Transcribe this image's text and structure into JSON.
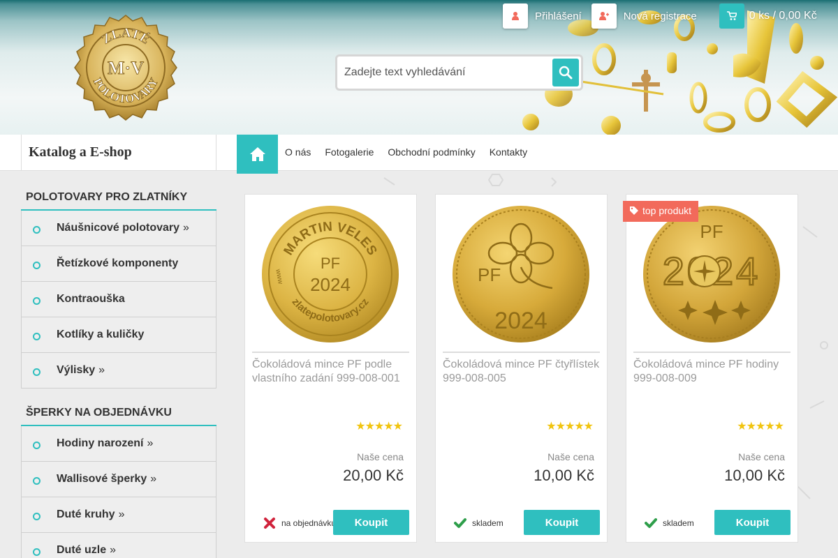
{
  "header": {
    "logo_text": {
      "top": "ZLATÉ",
      "center": "M·V",
      "bottom": "POLOTOVARY"
    },
    "login_label": "Přihlášení",
    "register_label": "Nová registrace",
    "cart_text": "0 ks / 0,00 Kč",
    "search_placeholder": "Zadejte text vyhledávání",
    "icons": {
      "login": "user-icon",
      "register": "user-plus-icon",
      "cart": "cart-icon",
      "search": "search-icon"
    }
  },
  "nav": {
    "catalog_title": "Katalog a E-shop",
    "home_icon": "home-icon",
    "items": [
      "O nás",
      "Fotogalerie",
      "Obchodní podmínky",
      "Kontakty"
    ]
  },
  "sidebar": {
    "sections": [
      {
        "title": "POLOTOVARY PRO ZLATNÍKY",
        "items": [
          {
            "label": "Náušnicové polotovary",
            "arrow": "»"
          },
          {
            "label": "Řetízkové komponenty",
            "arrow": ""
          },
          {
            "label": "Kontraouška",
            "arrow": ""
          },
          {
            "label": "Kotlíky a kuličky",
            "arrow": ""
          },
          {
            "label": "Výlisky",
            "arrow": "»"
          }
        ]
      },
      {
        "title": "ŠPERKY NA OBJEDNÁVKU",
        "items": [
          {
            "label": "Hodiny narození",
            "arrow": "»"
          },
          {
            "label": "Wallisové šperky",
            "arrow": "»"
          },
          {
            "label": "Duté kruhy",
            "arrow": "»"
          },
          {
            "label": "Duté uzle",
            "arrow": "»"
          }
        ]
      }
    ]
  },
  "products": [
    {
      "name": "Čokoládová mince PF podle vlastního zadání 999-008-001",
      "coin_text": {
        "ring": "MARTIN VELES",
        "ring2": "zlatepolotovary.cz",
        "center1": "PF",
        "center2": "2024",
        "side": "www"
      },
      "rating": "★★★★★",
      "price_label": "Naše cena",
      "price": "20,00 Kč",
      "stock": "na objednávku",
      "stock_status": "unavailable",
      "buy_label": "Koupit",
      "badge": ""
    },
    {
      "name": "Čokoládová mince PF čtyřlístek 999-008-005",
      "coin_text": {
        "left": "PF",
        "bottom": "2024"
      },
      "rating": "★★★★★",
      "price_label": "Naše cena",
      "price": "10,00 Kč",
      "stock": "skladem",
      "stock_status": "available",
      "buy_label": "Koupit",
      "badge": ""
    },
    {
      "name": "Čokoládová mince PF hodiny 999-008-009",
      "coin_text": {
        "top": "PF",
        "year": "2024"
      },
      "rating": "★★★★★",
      "price_label": "Naše cena",
      "price": "10,00 Kč",
      "stock": "skladem",
      "stock_status": "available",
      "buy_label": "Koupit",
      "badge": "top produkt"
    }
  ],
  "colors": {
    "accent": "#2fbfbf",
    "badge": "#f26a5b",
    "gold": "#d9b24a",
    "error": "#d0233c",
    "success": "#2e9e4a"
  }
}
